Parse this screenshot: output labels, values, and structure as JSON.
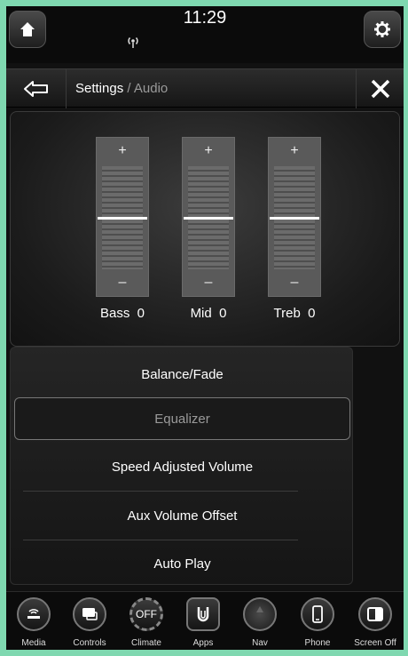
{
  "status": {
    "time": "11:29"
  },
  "header": {
    "breadcrumb_root": "Settings",
    "breadcrumb_sep": " / ",
    "breadcrumb_current": "Audio"
  },
  "equalizer": {
    "bands": [
      {
        "label": "Bass",
        "value": "0",
        "plus": "+",
        "minus": "–",
        "level": 0
      },
      {
        "label": "Mid",
        "value": "0",
        "plus": "+",
        "minus": "–",
        "level": 0
      },
      {
        "label": "Treb",
        "value": "0",
        "plus": "+",
        "minus": "–",
        "level": 0
      }
    ]
  },
  "menu": {
    "items": [
      {
        "label": "Balance/Fade",
        "selected": false
      },
      {
        "label": "Equalizer",
        "selected": true
      },
      {
        "label": "Speed Adjusted Volume",
        "selected": false
      },
      {
        "label": "Aux Volume Offset",
        "selected": false
      },
      {
        "label": "Auto Play",
        "selected": false
      }
    ]
  },
  "dock": {
    "items": [
      {
        "label": "Media",
        "icon": "media-icon"
      },
      {
        "label": "Controls",
        "icon": "controls-icon"
      },
      {
        "label": "Climate",
        "icon": "climate-icon",
        "icon_text": "OFF"
      },
      {
        "label": "Apps",
        "icon": "apps-icon"
      },
      {
        "label": "Nav",
        "icon": "nav-icon"
      },
      {
        "label": "Phone",
        "icon": "phone-icon"
      },
      {
        "label": "Screen Off",
        "icon": "screen-off-icon"
      }
    ]
  },
  "colors": {
    "screen_bg": "#111111",
    "frame_bg": "#7fd8b0",
    "dim_text": "#9a9a9a"
  }
}
